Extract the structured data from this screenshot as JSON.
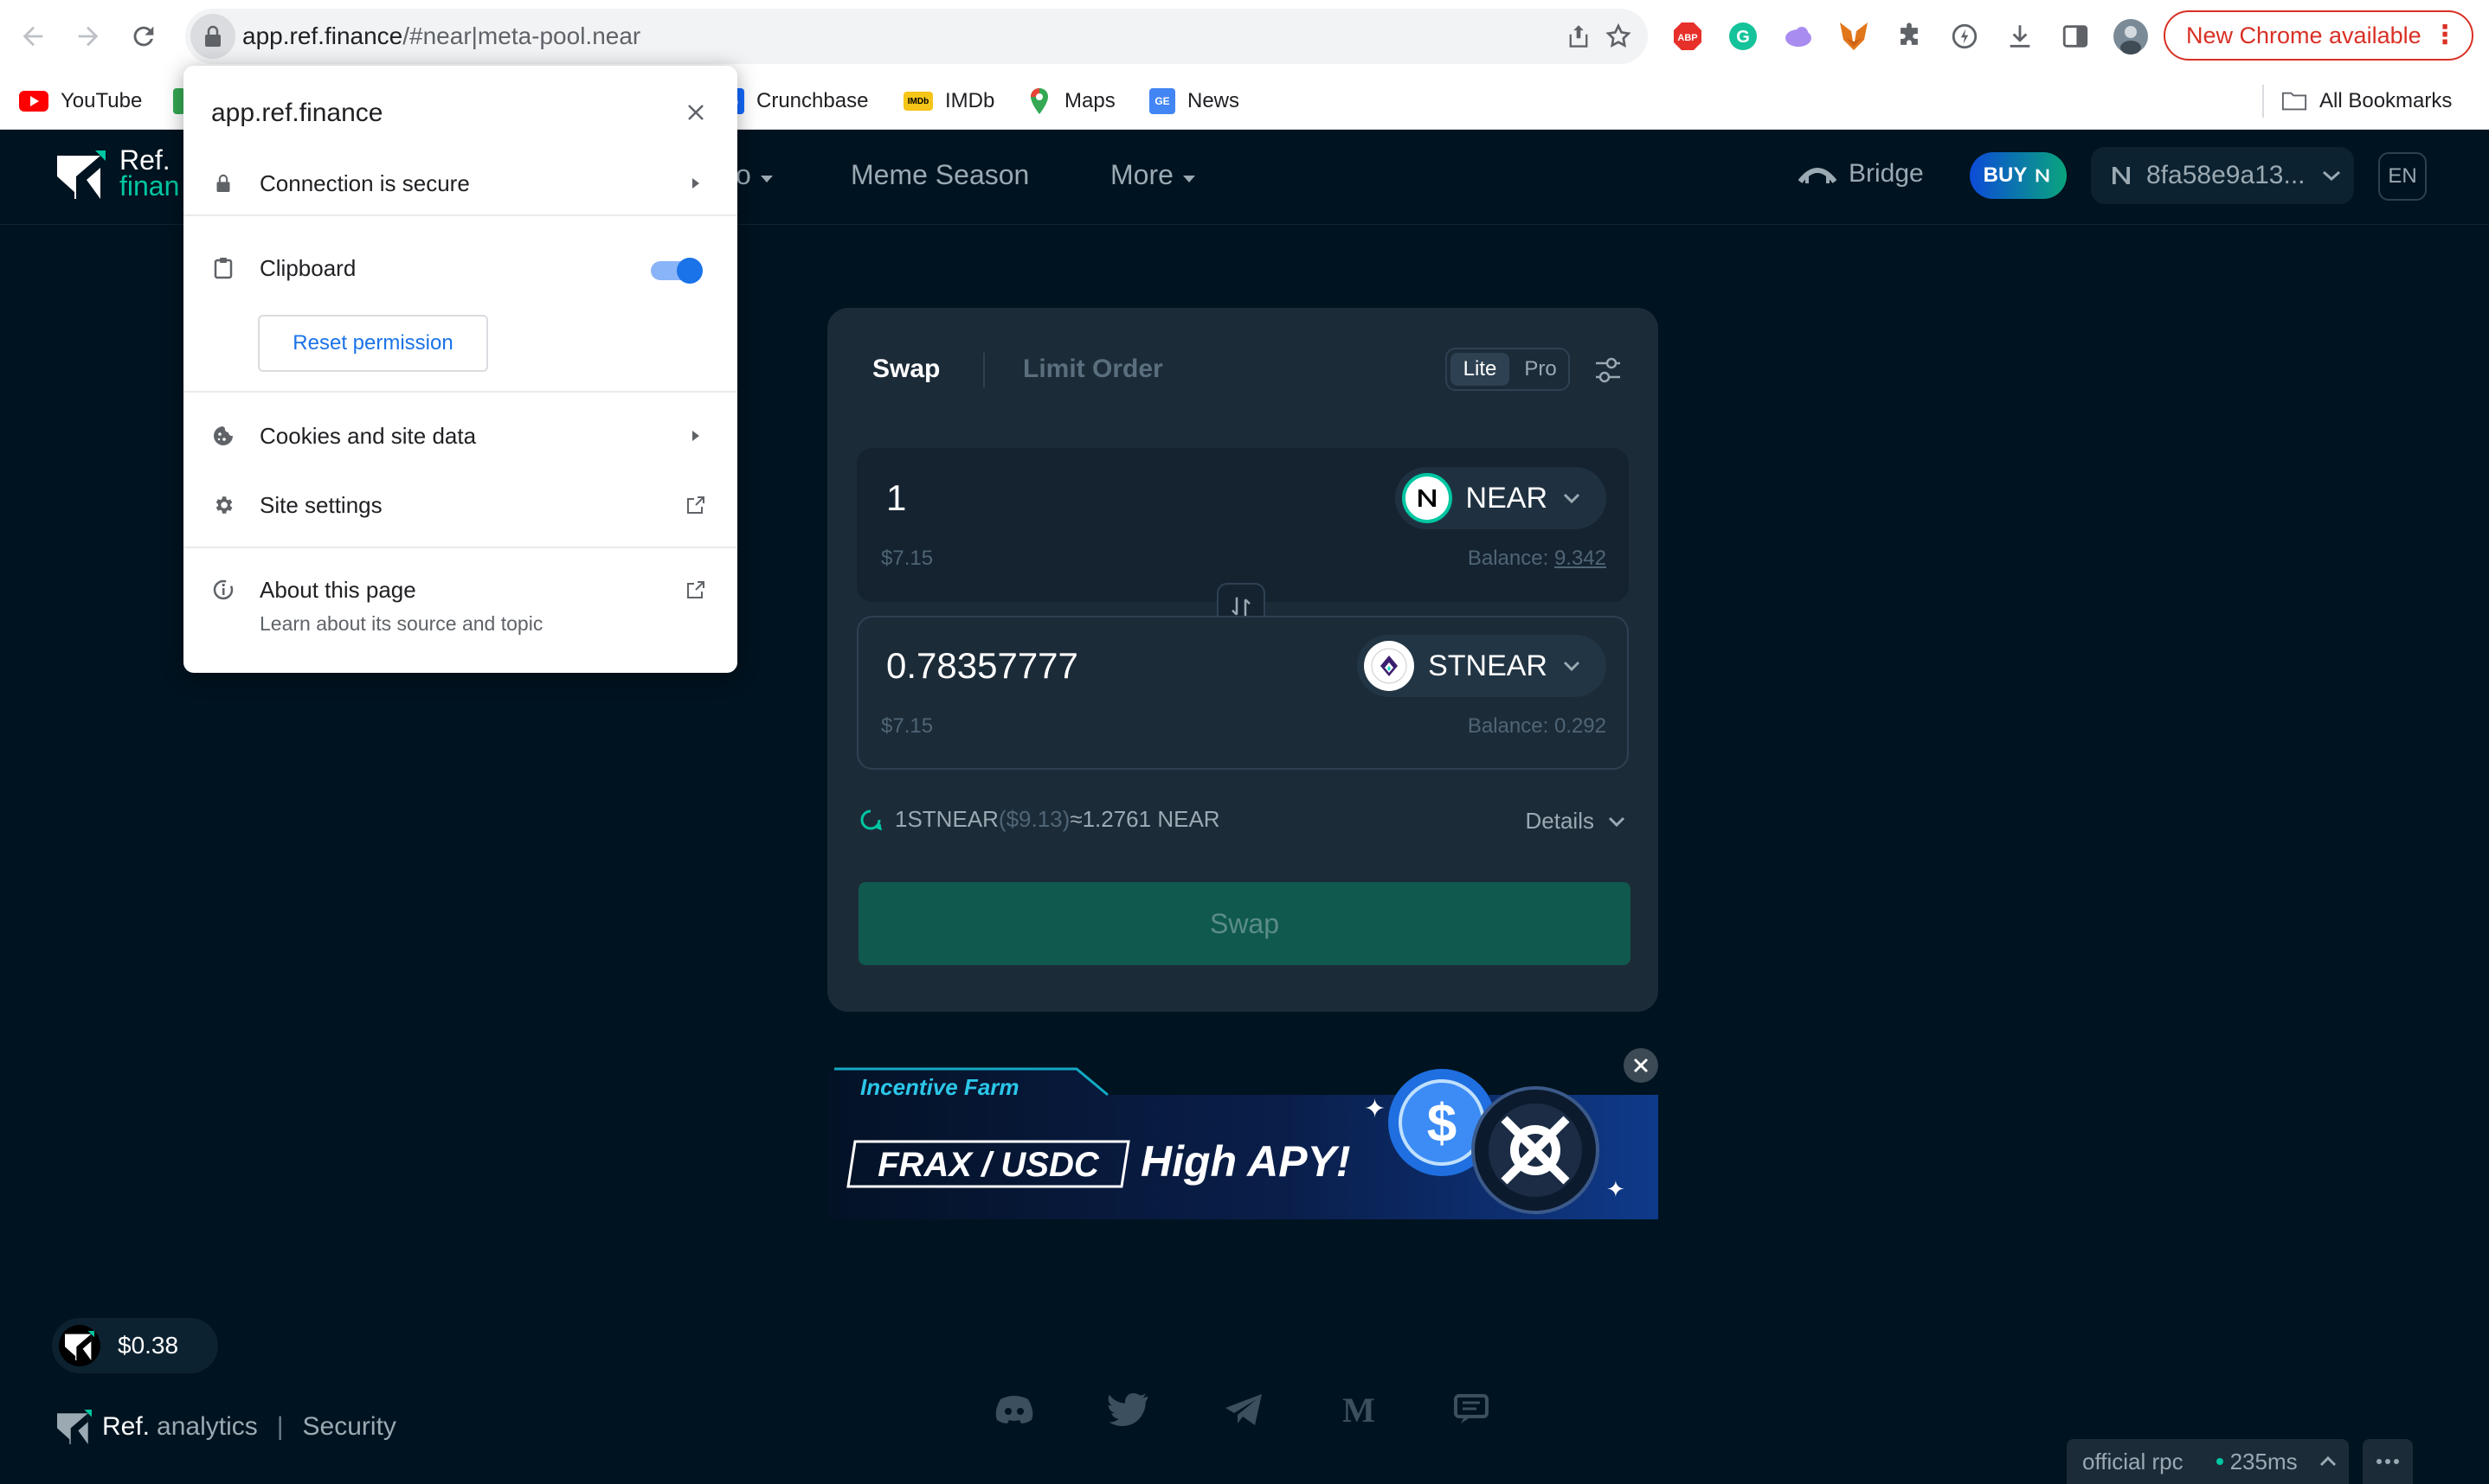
{
  "browser": {
    "url_host": "app.ref.finance",
    "url_path": "/#near|meta-pool.near",
    "new_chrome_label": "New Chrome available",
    "bookmarks": [
      {
        "label": "YouTube",
        "icon": "youtube-icon",
        "color": "#ff0000"
      },
      {
        "label": "Crunchbase",
        "icon": "crunchbase-icon",
        "color": "#146aff"
      },
      {
        "label": "IMDb",
        "icon": "imdb-icon",
        "color": "#f5c518"
      },
      {
        "label": "Maps",
        "icon": "maps-pin-icon",
        "color": "#34a853"
      },
      {
        "label": "News",
        "icon": "google-news-icon",
        "color": "#4285f4"
      }
    ],
    "all_bookmarks_label": "All Bookmarks"
  },
  "site_info_popup": {
    "title": "app.ref.finance",
    "connection_label": "Connection is secure",
    "clipboard_label": "Clipboard",
    "clipboard_enabled": true,
    "reset_permission_label": "Reset permission",
    "cookies_label": "Cookies and site data",
    "site_settings_label": "Site settings",
    "about_label": "About this page",
    "about_sub": "Learn about its source and topic"
  },
  "header": {
    "logo_line1": "Ref.",
    "logo_line2": "finan",
    "menu_partial": "o",
    "menu_meme": "Meme Season",
    "menu_more": "More",
    "bridge_label": "Bridge",
    "buy_label": "BUY",
    "wallet_label": "8fa58e9a13...",
    "lang_label": "EN"
  },
  "swap": {
    "tab_swap": "Swap",
    "tab_limit": "Limit Order",
    "mode_lite": "Lite",
    "mode_pro": "Pro",
    "from": {
      "amount": "1",
      "token": "NEAR",
      "usd": "$7.15",
      "balance_label": "Balance:",
      "balance": "9.342"
    },
    "to": {
      "amount": "0.78357777",
      "token": "STNEAR",
      "usd": "$7.15",
      "balance_label": "Balance:",
      "balance": "0.292"
    },
    "rate_prefix": "1STNEAR",
    "rate_usd": "($9.13)",
    "rate_suffix": "≈1.2761 NEAR",
    "details_label": "Details",
    "swap_button": "Swap"
  },
  "banner": {
    "tag": "Incentive Farm",
    "pair": "FRAX / USDC",
    "headline": "High APY!"
  },
  "footer": {
    "ref_price": "$0.38",
    "brand": "Ref.",
    "brand_sub": "analytics",
    "separator": "|",
    "security": "Security",
    "rpc_label": "official rpc",
    "rpc_latency": "235ms",
    "social_icons": [
      "discord-icon",
      "twitter-icon",
      "telegram-icon",
      "medium-icon",
      "forum-icon"
    ]
  },
  "colors": {
    "background": "#001320",
    "card": "#1c2b38",
    "accent": "#00c6a2",
    "swap_button": "#10594e"
  }
}
